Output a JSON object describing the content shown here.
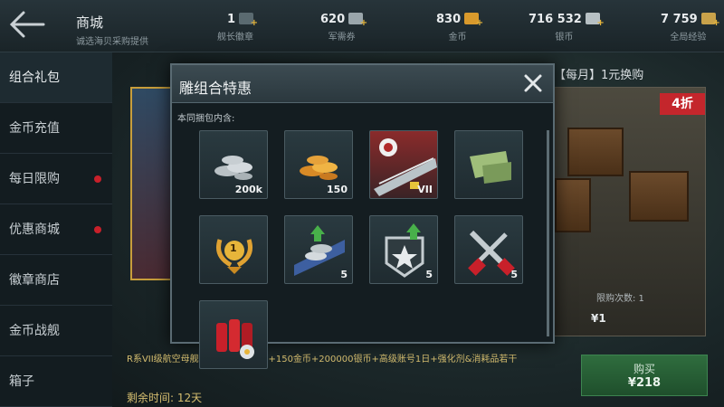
{
  "header": {
    "title": "商城",
    "subtitle": "诚选海贝采购提供",
    "resources": [
      {
        "value": "1",
        "label": "舰长徽章",
        "icon": "badge-icon"
      },
      {
        "value": "620",
        "label": "军需券",
        "icon": "ticket-icon"
      },
      {
        "value": "830",
        "label": "金币",
        "icon": "gold-coin-icon"
      },
      {
        "value": "716 532",
        "label": "银币",
        "icon": "silver-coin-icon"
      },
      {
        "value": "7 759",
        "label": "全局经验",
        "icon": "star-exp-icon"
      }
    ]
  },
  "sidebar": {
    "items": [
      {
        "label": "组合礼包",
        "active": true,
        "dot": false
      },
      {
        "label": "金币充值",
        "active": false,
        "dot": false
      },
      {
        "label": "每日限购",
        "active": false,
        "dot": true
      },
      {
        "label": "优惠商城",
        "active": false,
        "dot": true
      },
      {
        "label": "徽章商店",
        "active": false,
        "dot": false
      },
      {
        "label": "金币战舰",
        "active": false,
        "dot": false
      },
      {
        "label": "箱子",
        "active": false,
        "dot": false
      }
    ]
  },
  "shop": {
    "right_card_title": "【每月】1元换购",
    "discount": "4折",
    "limit": "限购次数: 1",
    "price_small": "¥1",
    "description": "R系VII级航空母舰\"雕\"+\"历史涂装\"+150金币+200000银币+高级账号1日+强化剂&消耗品若干",
    "remaining": "剩余时间: 12天",
    "buy_label": "购买",
    "buy_price": "¥218"
  },
  "modal": {
    "title": "雕组合特惠",
    "subtitle": "本同捆包内含:",
    "items": [
      {
        "name": "silver-coins-icon",
        "qty": "200k"
      },
      {
        "name": "gold-coins-icon",
        "qty": "150"
      },
      {
        "name": "aircraft-carrier-icon",
        "qty": "",
        "tier": "VII"
      },
      {
        "name": "camouflage-icon",
        "qty": ""
      },
      {
        "name": "premium-laurel-icon",
        "qty": "",
        "badge": "1"
      },
      {
        "name": "silver-boost-icon",
        "qty": "5"
      },
      {
        "name": "star-boost-icon",
        "qty": "5"
      },
      {
        "name": "tools-icon",
        "qty": "5"
      },
      {
        "name": "consumables-icon",
        "qty": ""
      }
    ]
  },
  "colors": {
    "gold": "#e7b53a",
    "red_dot": "#c8202a",
    "discount_red": "#c4262c",
    "buy_green": "#2f6d3e"
  }
}
